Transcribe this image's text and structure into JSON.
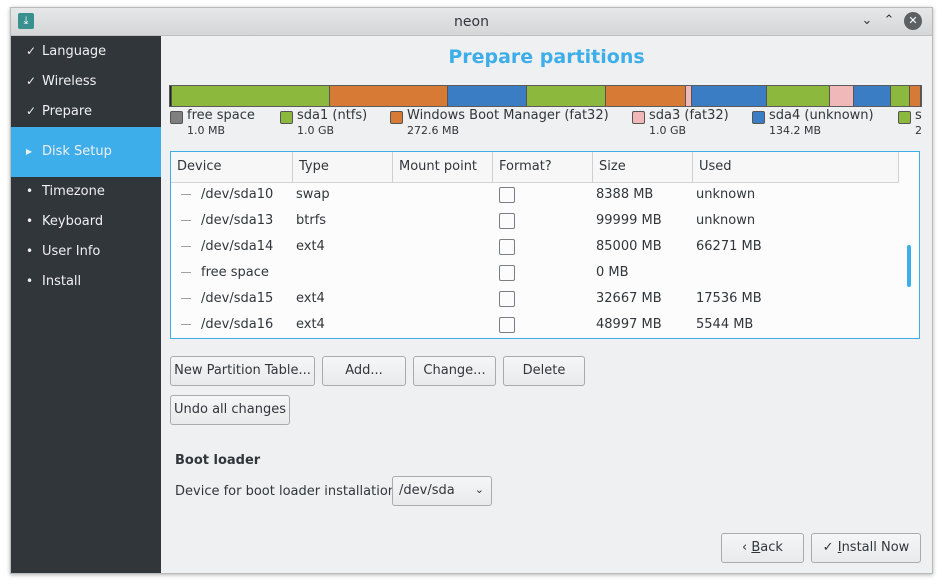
{
  "window": {
    "title": "neon",
    "icon": "download-arrow-icon"
  },
  "titlebar": {
    "minimize": "⌄",
    "maximize": "⌃",
    "close": "✕"
  },
  "sidebar": {
    "items": [
      {
        "mark": "✓",
        "label": "Language",
        "state": "done"
      },
      {
        "mark": "✓",
        "label": "Wireless",
        "state": "done"
      },
      {
        "mark": "✓",
        "label": "Prepare",
        "state": "done"
      },
      {
        "mark": "▸",
        "label": "Disk Setup",
        "state": "active"
      },
      {
        "mark": "•",
        "label": "Timezone",
        "state": "pending"
      },
      {
        "mark": "•",
        "label": "Keyboard",
        "state": "pending"
      },
      {
        "mark": "•",
        "label": "User Info",
        "state": "pending"
      },
      {
        "mark": "•",
        "label": "Install",
        "state": "pending"
      }
    ]
  },
  "main": {
    "title": "Prepare partitions"
  },
  "partition_bar": {
    "segments": [
      {
        "color": "#222222",
        "share": 0.3
      },
      {
        "color": "#8cb83e",
        "share": 21
      },
      {
        "color": "#d67a35",
        "share": 15.7
      },
      {
        "color": "#3b7dc4",
        "share": 10.5
      },
      {
        "color": "#8cb83e",
        "share": 10.5
      },
      {
        "color": "#d67a35",
        "share": 10.7
      },
      {
        "color": "#f0b8b8",
        "share": 0.8
      },
      {
        "color": "#3b7dc4",
        "share": 10
      },
      {
        "color": "#8cb83e",
        "share": 8.4
      },
      {
        "color": "#f0b8b8",
        "share": 3.2
      },
      {
        "color": "#3b7dc4",
        "share": 4.9
      },
      {
        "color": "#8cb83e",
        "share": 2.5
      },
      {
        "color": "#d67a35",
        "share": 1.5
      }
    ]
  },
  "legend": [
    {
      "name": "free space",
      "size": "1.0 MB",
      "color": "#7f7f7f"
    },
    {
      "name": "sda1 (ntfs)",
      "size": "1.0 GB",
      "color": "#8cb83e"
    },
    {
      "name": "Windows Boot Manager (fat32)",
      "size": "272.6 MB",
      "color": "#d67a35"
    },
    {
      "name": "sda3 (fat32)",
      "size": "1.0 GB",
      "color": "#f0b8b8"
    },
    {
      "name": "sda4 (unknown)",
      "size": "134.2 MB",
      "color": "#3b7dc4"
    },
    {
      "name": "s",
      "size": "2",
      "color": "#8cb83e"
    }
  ],
  "table": {
    "columns": [
      "Device",
      "Type",
      "Mount point",
      "Format?",
      "Size",
      "Used"
    ],
    "rows": [
      {
        "device": "/dev/sda10",
        "type": "swap",
        "mount": "",
        "format": false,
        "size": "8388 MB",
        "used": "unknown"
      },
      {
        "device": "/dev/sda13",
        "type": "btrfs",
        "mount": "",
        "format": false,
        "size": "99999 MB",
        "used": "unknown"
      },
      {
        "device": "/dev/sda14",
        "type": "ext4",
        "mount": "",
        "format": false,
        "size": "85000 MB",
        "used": "66271 MB"
      },
      {
        "device": "free space",
        "type": "",
        "mount": "",
        "format": false,
        "size": "0 MB",
        "used": ""
      },
      {
        "device": "/dev/sda15",
        "type": "ext4",
        "mount": "",
        "format": false,
        "size": "32667 MB",
        "used": "17536 MB"
      },
      {
        "device": "/dev/sda16",
        "type": "ext4",
        "mount": "",
        "format": false,
        "size": "48997 MB",
        "used": "5544 MB"
      }
    ]
  },
  "actions": {
    "new_table": "New Partition Table...",
    "add": "Add...",
    "change": "Change...",
    "delete": "Delete",
    "undo": "Undo all changes"
  },
  "bootloader": {
    "title": "Boot loader",
    "label": "Device for boot loader installation:",
    "value": "/dev/sda"
  },
  "footer": {
    "back_icon": "‹",
    "back_accel": "B",
    "back_rest": "ack",
    "install_icon": "✓",
    "install_accel": "I",
    "install_rest": "nstall Now"
  },
  "colors": {
    "accent": "#3daee9",
    "sidebar_bg": "#31363b",
    "window_bg": "#eff0f1"
  }
}
